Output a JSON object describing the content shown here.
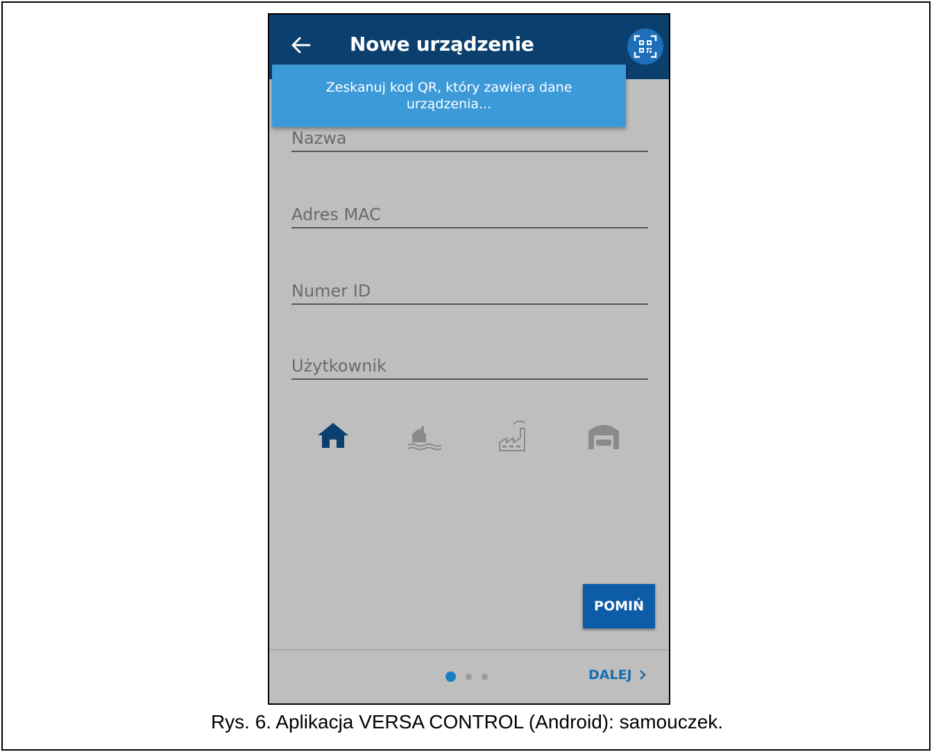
{
  "header": {
    "title": "Nowe urządzenie",
    "back_icon": "arrow-left-icon",
    "qr_icon": "qr-code-icon"
  },
  "toast": {
    "message": "Zeskanuj kod QR, który zawiera dane urządzenia..."
  },
  "form": {
    "fields": [
      {
        "placeholder": "Nazwa",
        "value": ""
      },
      {
        "placeholder": "Adres MAC",
        "value": ""
      },
      {
        "placeholder": "Numer ID",
        "value": ""
      },
      {
        "placeholder": "Użytkownik",
        "value": ""
      }
    ],
    "object_types": [
      {
        "icon": "house-icon",
        "selected": true
      },
      {
        "icon": "lake-house-icon",
        "selected": false
      },
      {
        "icon": "factory-icon",
        "selected": false
      },
      {
        "icon": "garage-icon",
        "selected": false
      }
    ]
  },
  "actions": {
    "skip_label": "POMIŃ",
    "next_label": "DALEJ",
    "next_icon": "chevron-right-icon"
  },
  "pagination": {
    "current": 1,
    "total": 3
  },
  "colors": {
    "appbar": "#0b3f6e",
    "toast": "#3d9ad9",
    "accent": "#0d5ca8",
    "overlay": "#bebebe"
  },
  "caption": "Rys. 6. Aplikacja VERSA CONTROL (Android): samouczek."
}
